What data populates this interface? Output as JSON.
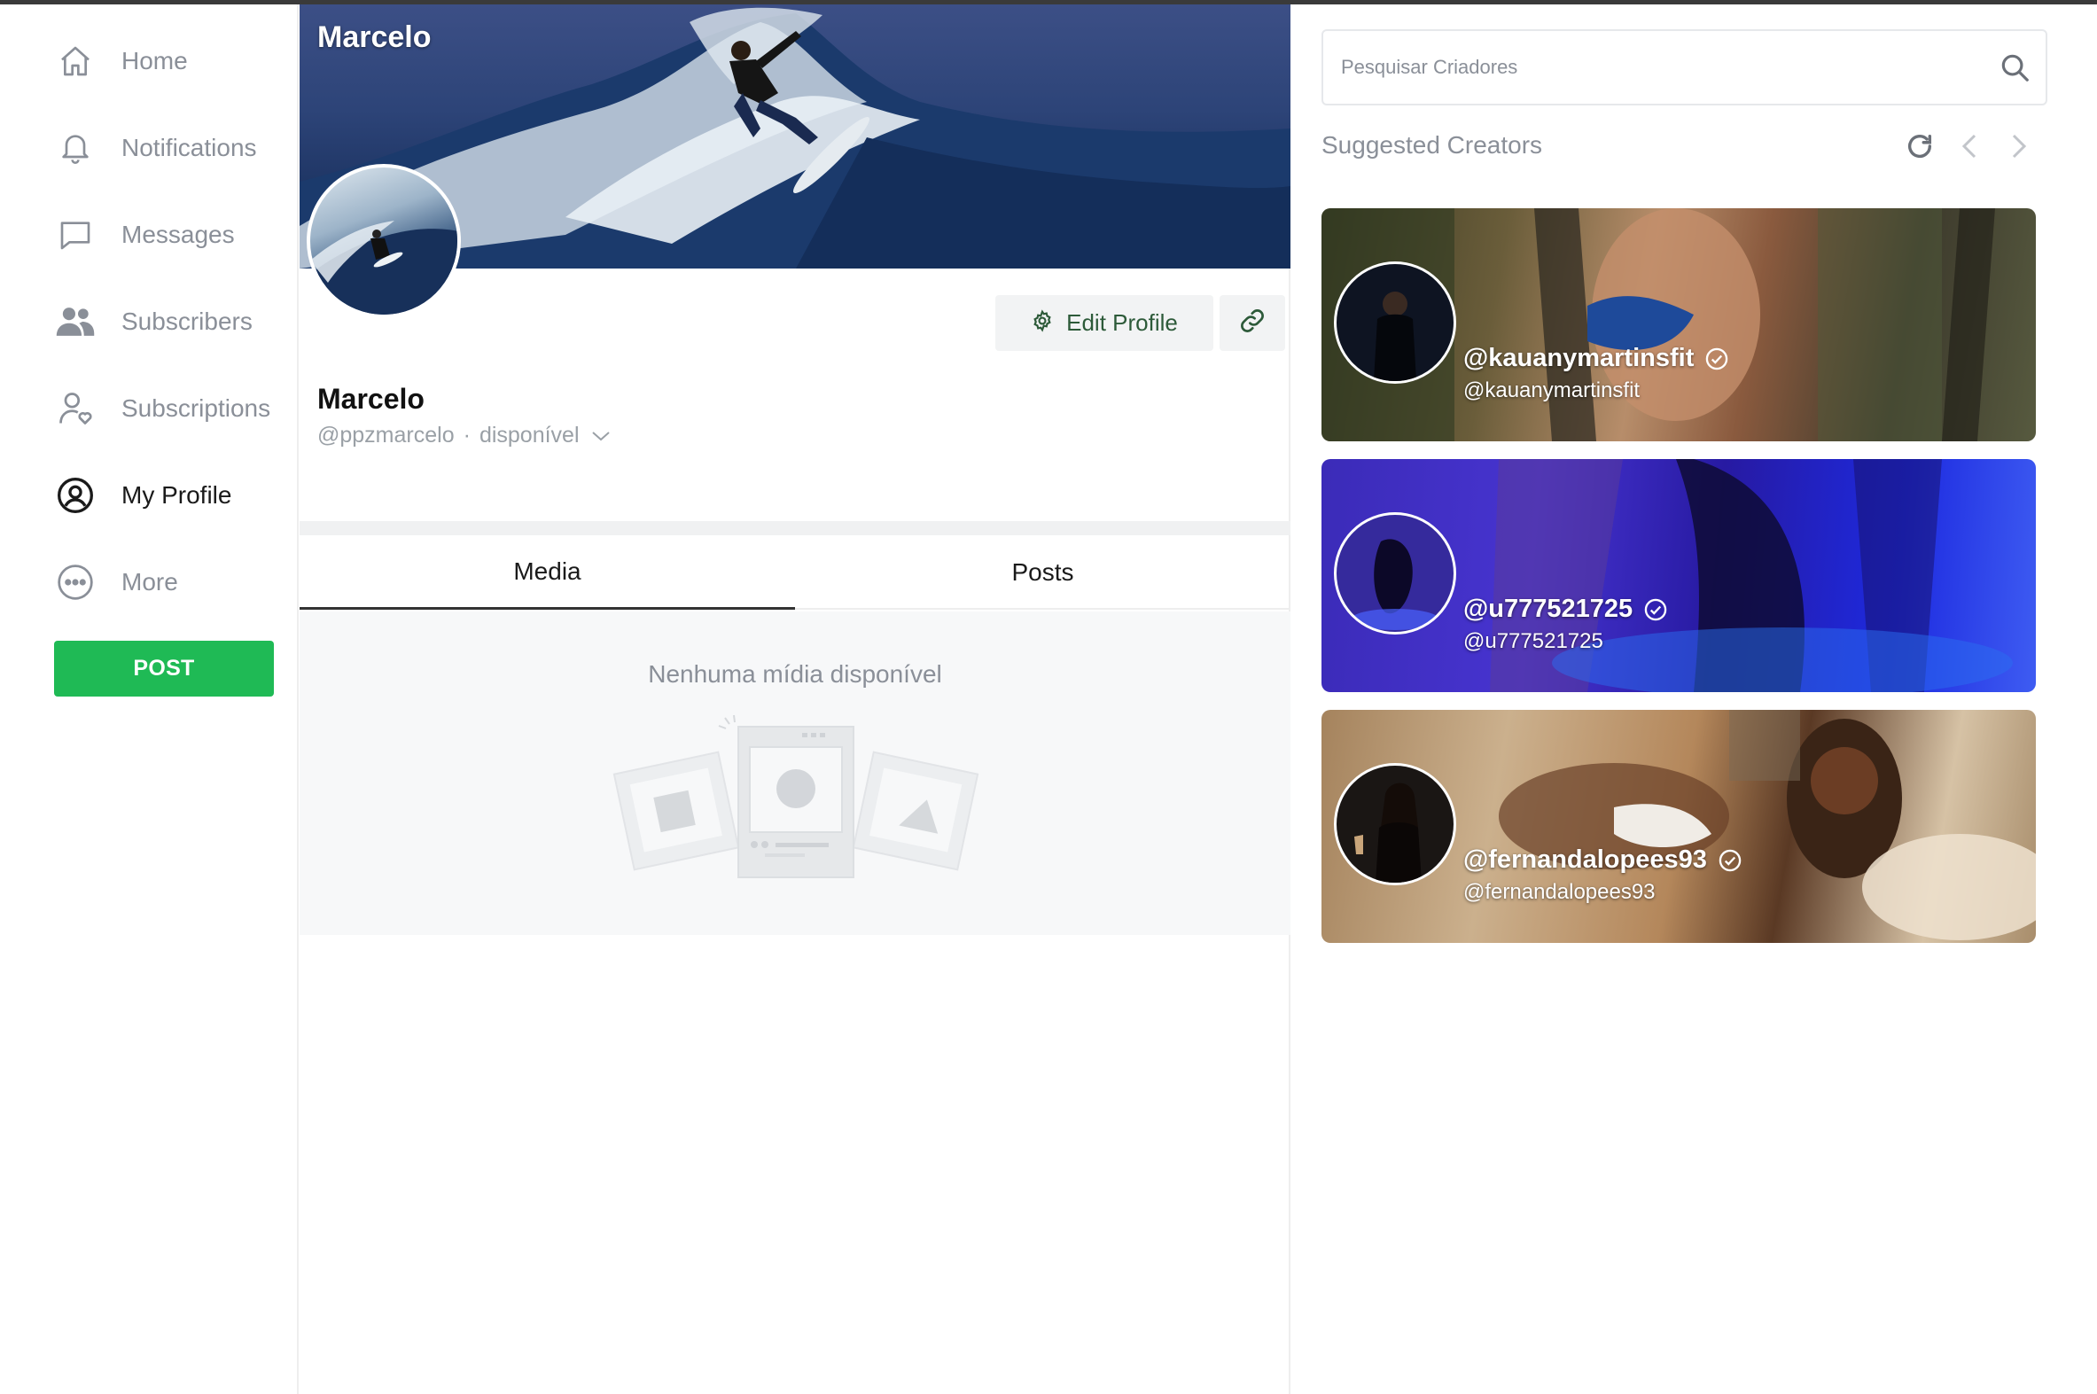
{
  "sidebar": {
    "items": [
      {
        "label": "Home",
        "icon": "home-icon"
      },
      {
        "label": "Notifications",
        "icon": "bell-icon"
      },
      {
        "label": "Messages",
        "icon": "message-icon"
      },
      {
        "label": "Subscribers",
        "icon": "users-icon"
      },
      {
        "label": "Subscriptions",
        "icon": "user-heart-icon"
      },
      {
        "label": "My Profile",
        "icon": "user-circle-icon",
        "active": true
      },
      {
        "label": "More",
        "icon": "more-icon"
      }
    ],
    "post_label": "POST",
    "post_color": "#1fba55"
  },
  "profile": {
    "cover_name": "Marcelo",
    "name": "Marcelo",
    "handle": "@ppzmarcelo",
    "status": "disponível",
    "edit_label": "Edit Profile"
  },
  "tabs": [
    {
      "label": "Media",
      "active": true
    },
    {
      "label": "Posts",
      "active": false
    }
  ],
  "media": {
    "empty_text": "Nenhuma mídia disponível"
  },
  "search": {
    "placeholder": "Pesquisar Criadores"
  },
  "suggested": {
    "title": "Suggested Creators",
    "creators": [
      {
        "name": "@kauanymartinsfit",
        "handle": "@kauanymartinsfit",
        "verified": true
      },
      {
        "name": "@u777521725",
        "handle": "@u777521725",
        "verified": true
      },
      {
        "name": "@fernandalopees93",
        "handle": "@fernandalopees93",
        "verified": true
      }
    ]
  }
}
